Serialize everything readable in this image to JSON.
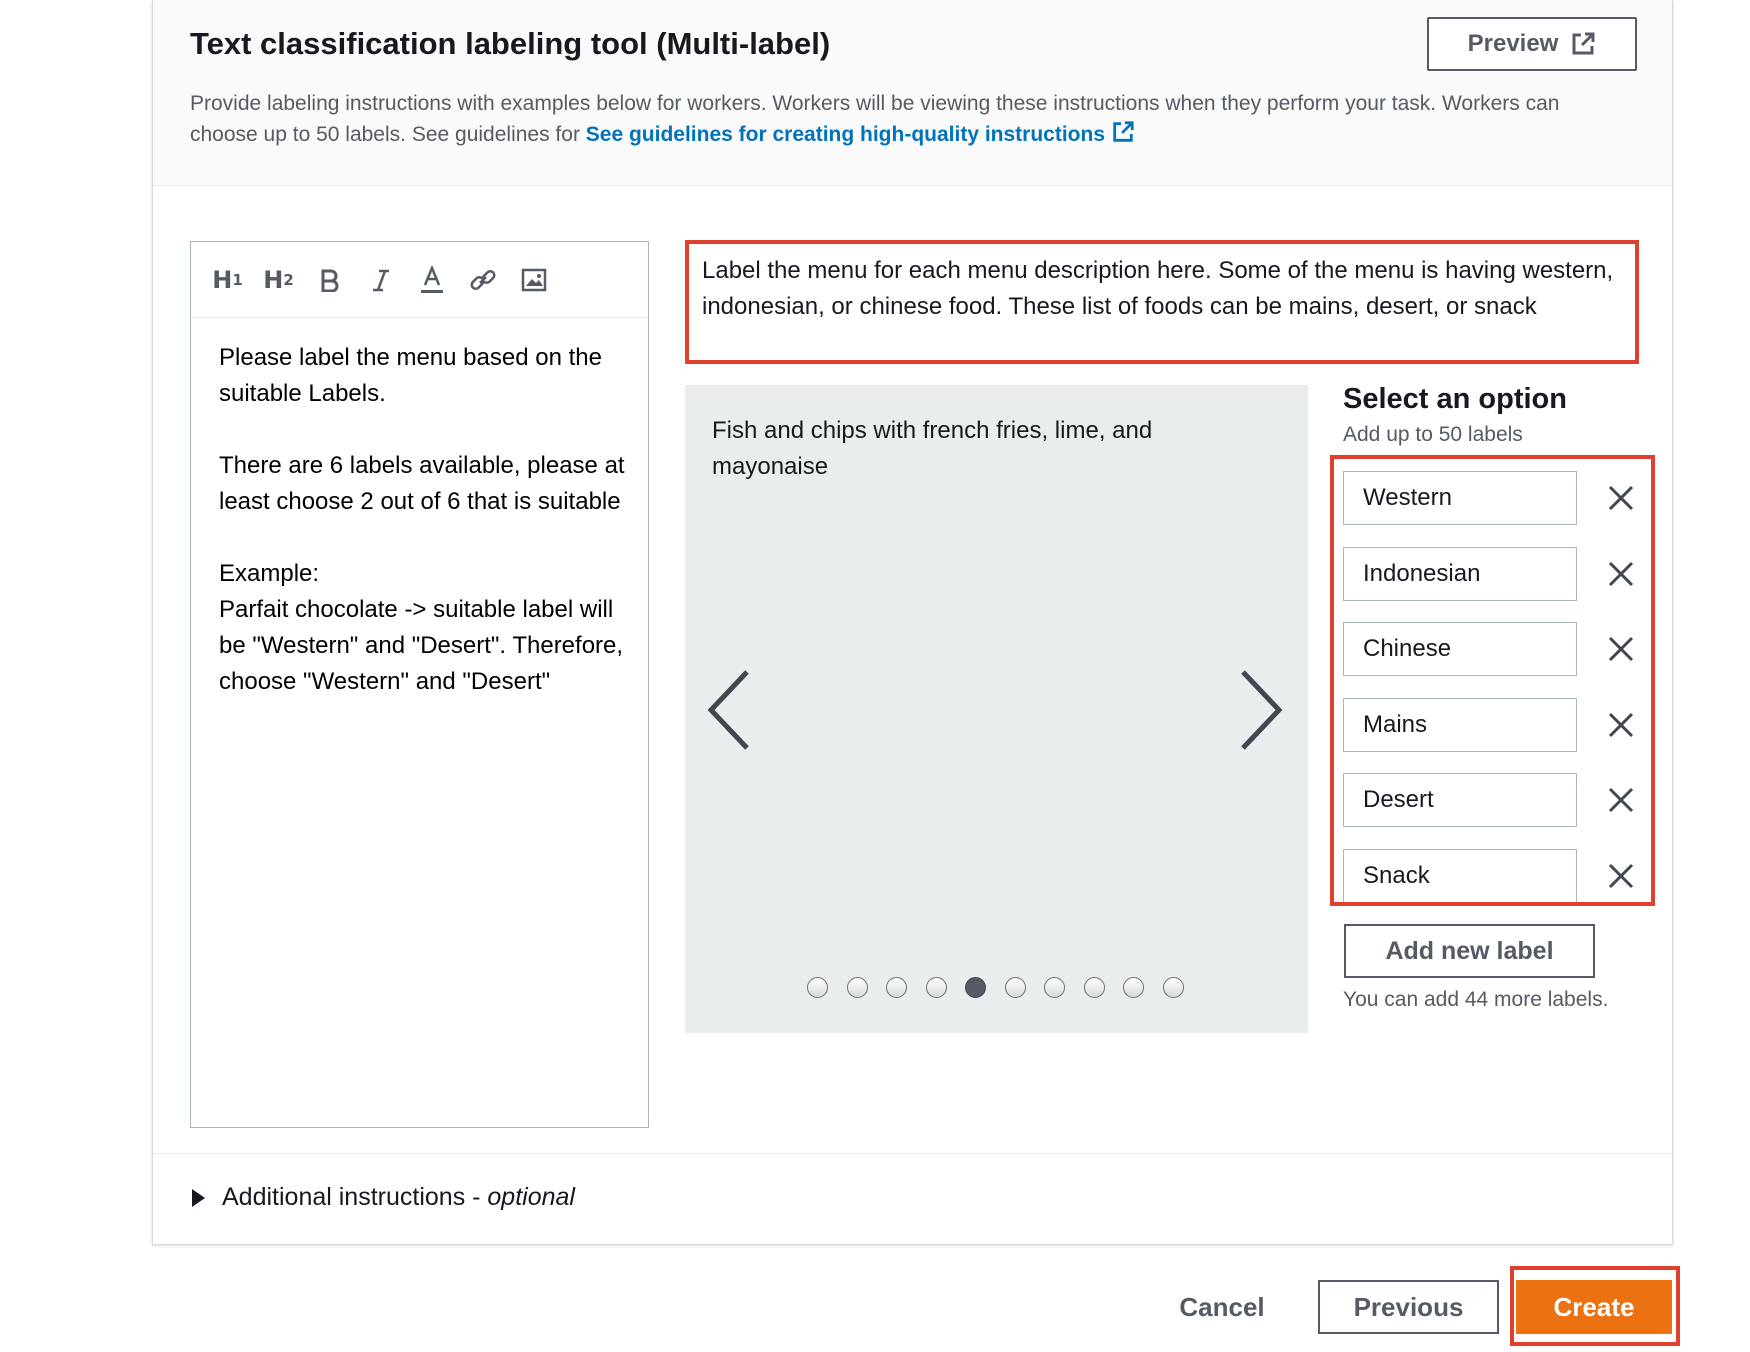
{
  "header": {
    "title": "Text classification labeling tool (Multi-label)",
    "preview_label": "Preview",
    "description": "Provide labeling instructions with examples below for workers. Workers will be viewing these instructions when they perform your task. Workers can choose up to 50 labels. See guidelines for ",
    "guidelines_link": "See guidelines for creating high-quality instructions"
  },
  "editor": {
    "toolbar": [
      {
        "name": "heading1-icon",
        "text": "H",
        "sub": "1"
      },
      {
        "name": "heading2-icon",
        "text": "H",
        "sub": "2"
      },
      {
        "name": "bold-icon"
      },
      {
        "name": "italic-icon"
      },
      {
        "name": "font-color-icon"
      },
      {
        "name": "link-icon"
      },
      {
        "name": "image-icon"
      }
    ],
    "paragraphs": [
      "Please label the menu based on the suitable Labels.",
      "There are 6 labels available, please at least choose 2 out of 6 that is suitable",
      "Example:\nParfait chocolate -> suitable label will be \"Western\" and \"Desert\". Therefore, choose \"Western\" and \"Desert\""
    ]
  },
  "task_header": "Label the menu for each menu description here. Some of the menu is having western, indonesian, or chinese food. These list of foods can be mains, desert, or snack",
  "preview": {
    "text": "Fish and chips with french fries, lime, and mayonaise",
    "dot_count": 10,
    "active_dot": 4
  },
  "options": {
    "title": "Select an option",
    "subtitle": "Add up to 50 labels",
    "labels": [
      "Western",
      "Indonesian",
      "Chinese",
      "Mains",
      "Desert",
      "Snack"
    ],
    "add_label_button": "Add new label",
    "remaining_text": "You can add 44 more labels."
  },
  "additional": {
    "label": "Additional instructions - ",
    "optional": "optional"
  },
  "footer": {
    "cancel": "Cancel",
    "previous": "Previous",
    "create": "Create"
  },
  "colors": {
    "primary": "#ec7211",
    "link": "#0073bb",
    "highlight": "#e0412f"
  }
}
